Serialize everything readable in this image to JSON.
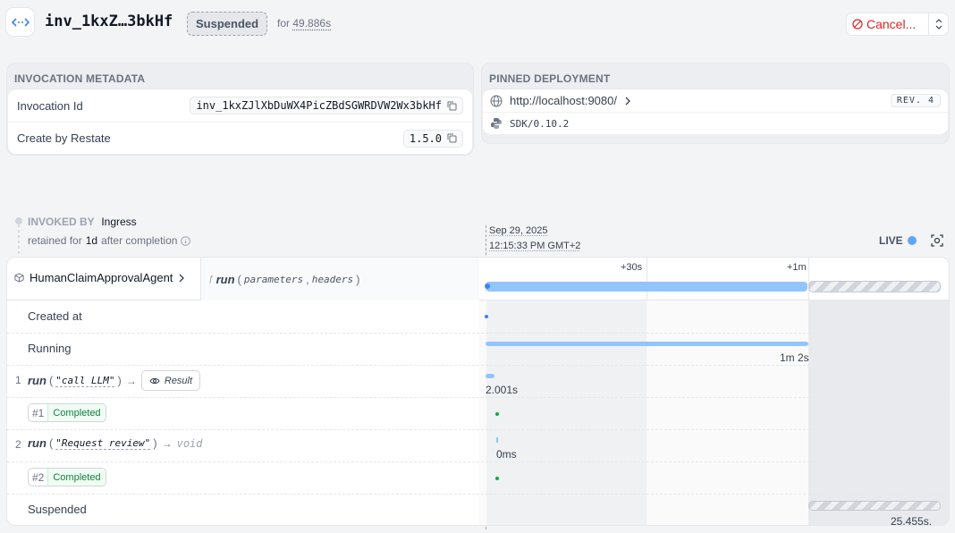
{
  "header": {
    "invocation_id_short": "inv_1kxZ…3bkHf",
    "status": "Suspended",
    "for_prefix": "for",
    "duration": "49.886s",
    "cancel_label": "Cancel..."
  },
  "metadata": {
    "title": "INVOCATION METADATA",
    "rows": [
      {
        "label": "Invocation Id",
        "value": "inv_1kxZJlXbDuWX4PicZBdSGWRDVW2Wx3bkHf"
      },
      {
        "label": "Create by Restate",
        "value": "1.5.0"
      }
    ]
  },
  "deployment": {
    "title": "PINNED DEPLOYMENT",
    "url": "http://localhost:9080/",
    "revision": "REV. 4",
    "sdk": "SDK/0.10.2"
  },
  "invoked": {
    "label": "INVOKED BY",
    "value": "Ingress",
    "retained_prefix": "retained for",
    "retained_value": "1d",
    "retained_suffix": "after completion"
  },
  "timeline_header": {
    "date": "Sep 29, 2025",
    "time": "12:15:33 PM GMT+2",
    "live_label": "LIVE",
    "ticks": [
      "+30s",
      "+1m"
    ]
  },
  "service": {
    "name": "HumanClaimApprovalAgent",
    "handler": "run",
    "params": [
      "parameters",
      "headers"
    ]
  },
  "rows": {
    "created_at": "Created at",
    "running": "Running",
    "running_duration": "1m 2s",
    "step1_index": "1",
    "step1_fn": "run",
    "step1_arg": "\"call LLM\"",
    "step1_result": "Result",
    "step1_duration": "2.001s",
    "step1_num": "#1",
    "step1_status": "Completed",
    "step2_index": "2",
    "step2_fn": "run",
    "step2_arg": "\"Request review\"",
    "step2_return": "void",
    "step2_duration": "0ms",
    "step2_num": "#2",
    "step2_status": "Completed",
    "suspended": "Suspended",
    "suspended_duration": "25.455s."
  },
  "colors": {
    "accent": "#60a5fa",
    "bar": "#93c5fd",
    "danger": "#dc2626",
    "success": "#16a34a"
  }
}
